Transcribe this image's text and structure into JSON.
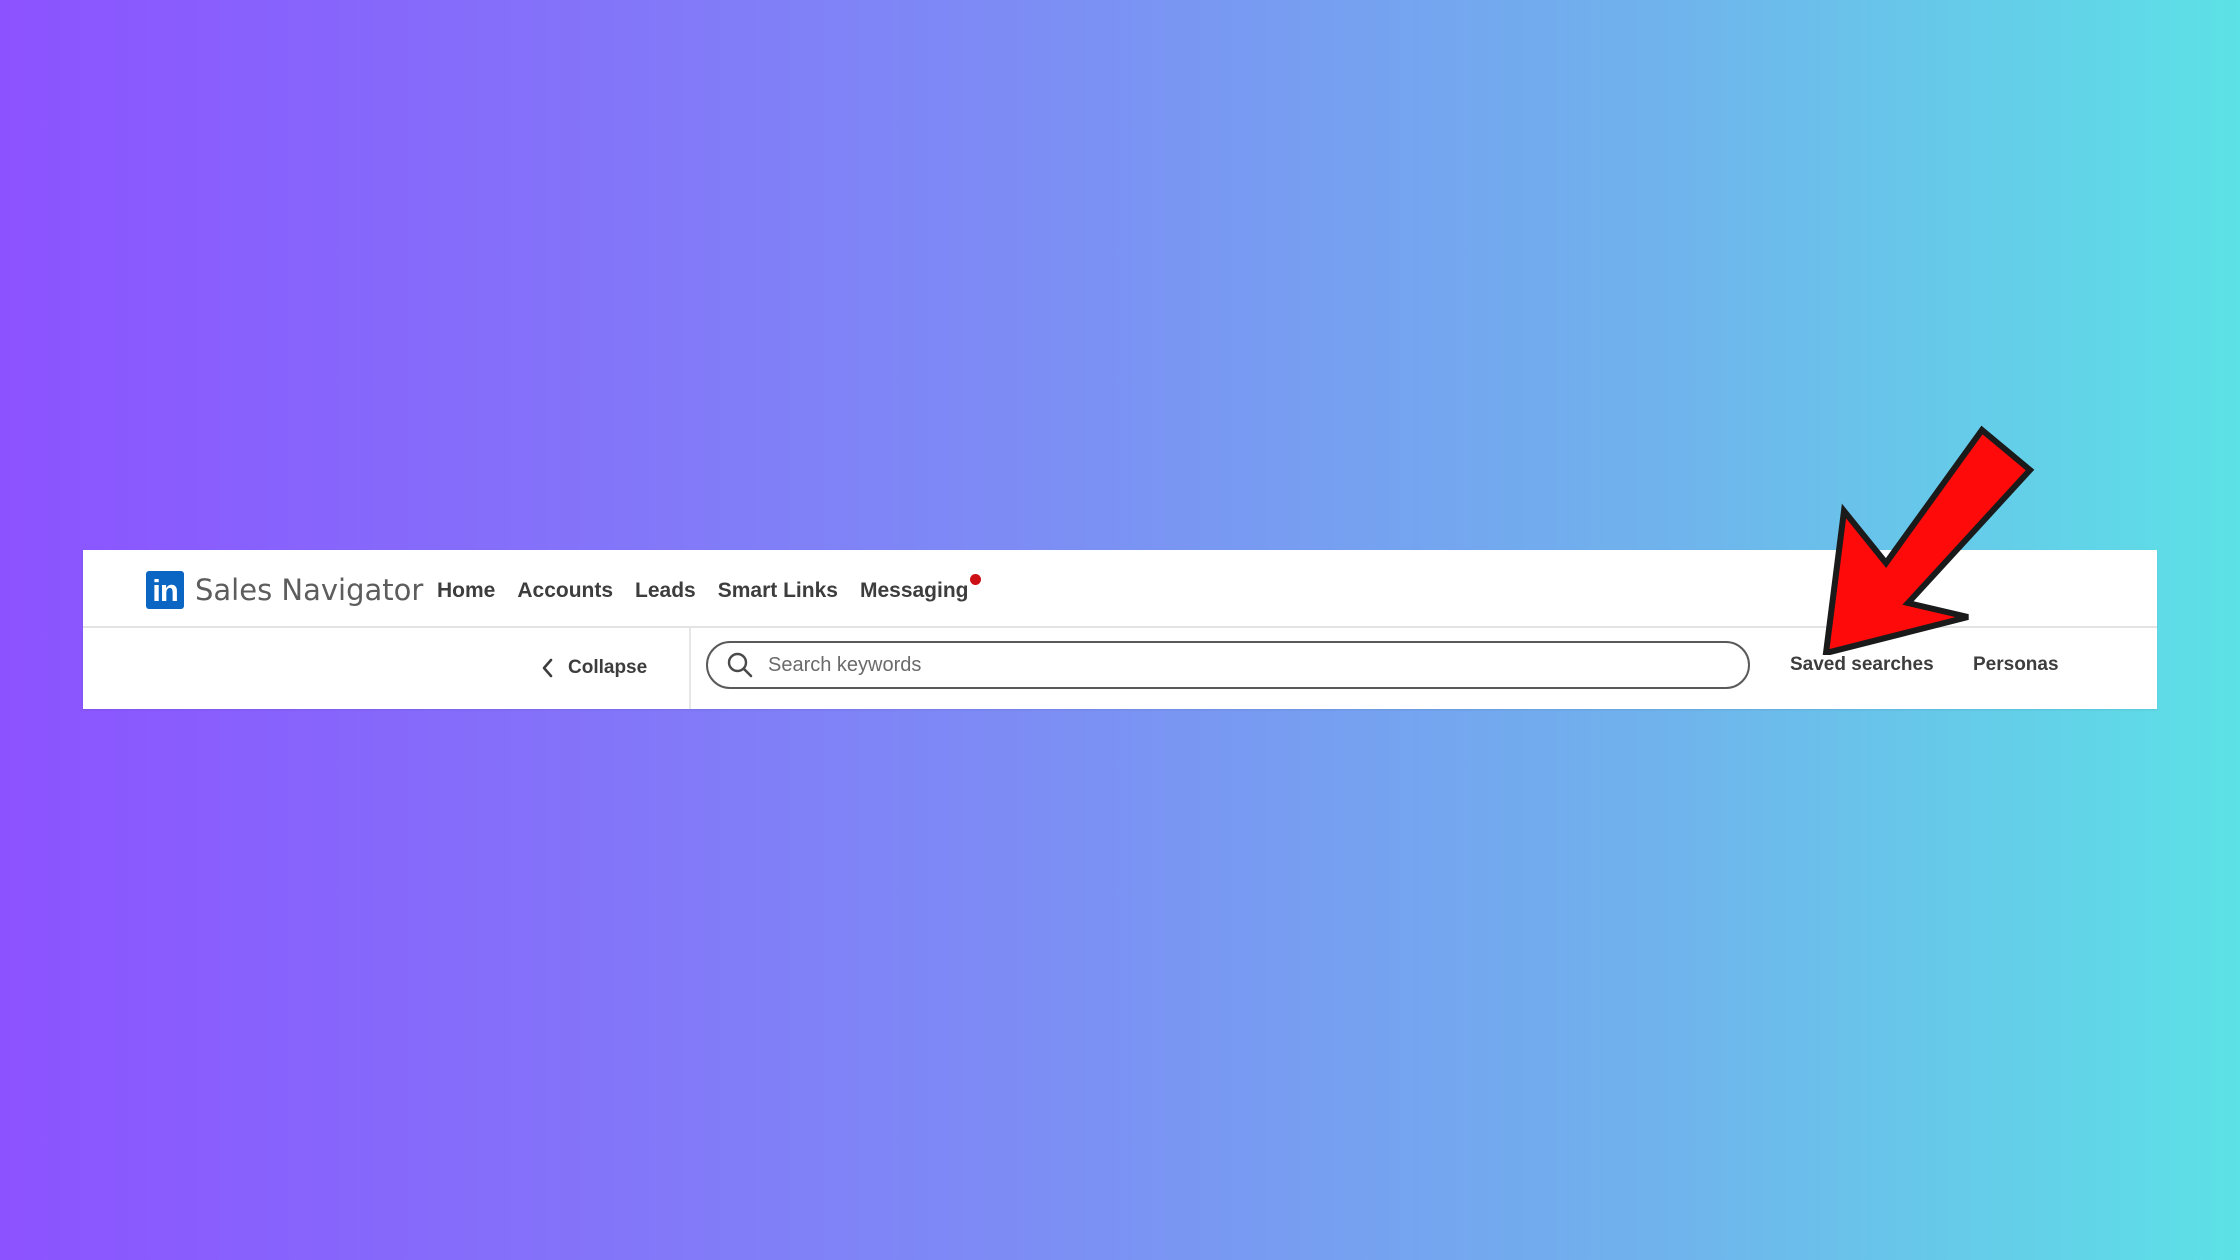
{
  "header": {
    "logo_text": "in",
    "brand": "Sales Navigator",
    "brand_color": "#0a66c2",
    "nav": [
      {
        "label": "Home"
      },
      {
        "label": "Accounts"
      },
      {
        "label": "Leads"
      },
      {
        "label": "Smart Links"
      },
      {
        "label": "Messaging",
        "has_notification": true
      }
    ],
    "notification_color": "#cc1016"
  },
  "subbar": {
    "collapse_label": "Collapse",
    "search": {
      "placeholder": "Search keywords",
      "value": ""
    },
    "saved_searches_label": "Saved searches",
    "personas_label": "Personas"
  },
  "annotation": {
    "arrow_icon": "red-arrow-icon",
    "arrow_color": "#ff0000"
  },
  "background": {
    "gradient_start": "#8c52ff",
    "gradient_end": "#5ce1e6"
  }
}
